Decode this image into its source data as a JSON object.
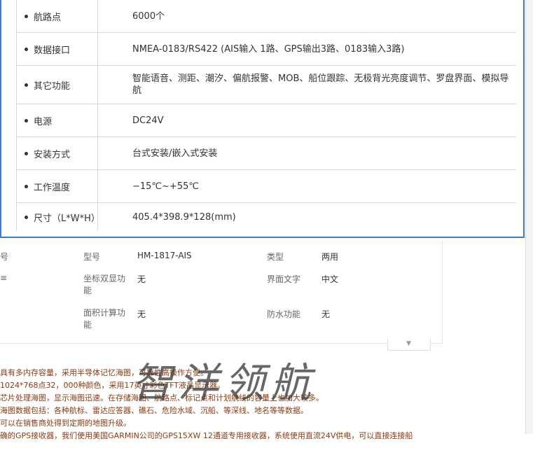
{
  "specs": [
    {
      "label": "航路点",
      "value": "6000个"
    },
    {
      "label": "数据接口",
      "value": "NMEA-0183/RS422 (AIS输入 1路、GPS输出3路、0183输入3路)"
    },
    {
      "label": "其它功能",
      "value": "智能语音、测距、潮汐、偏航报警、MOB、船位跟踪、无极背光亮度调节、罗盘界面、模拟导航"
    },
    {
      "label": "电源",
      "value": "DC24V"
    },
    {
      "label": "安装方式",
      "value": "台式安装/嵌入式安装"
    },
    {
      "label": "工作温度",
      "value": "−15℃~+55℃"
    },
    {
      "label": "尺寸（L*W*H）",
      "value": "405.4*398.9*128(mm)"
    }
  ],
  "attrs": {
    "left_cut_1": "号",
    "left_cut_2": "≡",
    "model_label": "型号",
    "model_value": "HM-1817-AIS",
    "type_label": "类型",
    "type_value": "两用",
    "dual_label": "坐标双显功能",
    "dual_value": "无",
    "lang_label": "界面文字",
    "lang_value": "中文",
    "area_label": "面积计算功能",
    "area_value": "无",
    "water_label": "防水功能",
    "water_value": "无",
    "expand_icon": "chevron-down-icon"
  },
  "features": [
    "具有多内存容量，采用半导体记忆海图，可靠性高操作方便。",
    "1024*768点32，000种颜色，采用17英寸彩色TFT液晶显示器。",
    "芯片处理海图，显示海图迅速。在存储海图、航路点、标记点和计划航线的容量上也加大较多。",
    "海图数据包括：各种航标、雷达应答器、礁石、危险水域、沉船、等深线、地名等等数据。",
    "可以在销售商处得到定期的地图升级。",
    "确的GPS接收器，我们使用美国GARMIN公司的GPS15XW 12通道专用接收器，系统使用直流24V供电，可以直接连接船"
  ],
  "watermark": "智洋领航",
  "colors": {
    "border": "#3a7fc8",
    "feature_text": "#8b3a12"
  }
}
